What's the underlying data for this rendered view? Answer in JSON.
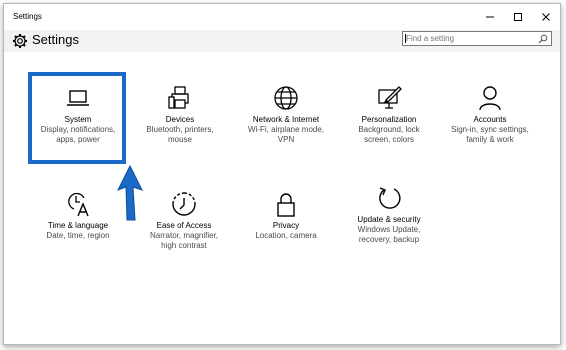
{
  "window": {
    "title": "Settings",
    "minimize": "─",
    "maximize": "☐",
    "close": "✕"
  },
  "header": {
    "title": "Settings",
    "search_placeholder": "Find a setting"
  },
  "accent": "#1b6ac8",
  "tiles": [
    {
      "name": "System",
      "desc1": "Display, notifications,",
      "desc2": "apps, power",
      "icon": "laptop-icon"
    },
    {
      "name": "Devices",
      "desc1": "Bluetooth, printers,",
      "desc2": "mouse",
      "icon": "devices-icon"
    },
    {
      "name": "Network & Internet",
      "desc1": "Wi-Fi, airplane mode,",
      "desc2": "VPN",
      "icon": "globe-icon"
    },
    {
      "name": "Personalization",
      "desc1": "Background, lock",
      "desc2": "screen, colors",
      "icon": "paint-icon"
    },
    {
      "name": "Accounts",
      "desc1": "Sign-in, sync settings,",
      "desc2": "family & work",
      "icon": "person-icon"
    },
    {
      "name": "Time & language",
      "desc1": "Date, time, region",
      "desc2": "",
      "icon": "time-language-icon"
    },
    {
      "name": "Ease of Access",
      "desc1": "Narrator, magnifier,",
      "desc2": "high contrast",
      "icon": "ease-of-access-icon"
    },
    {
      "name": "Privacy",
      "desc1": "Location, camera",
      "desc2": "",
      "icon": "lock-icon"
    },
    {
      "name": "Update & security",
      "desc1": "Windows Update,",
      "desc2": "recovery, backup",
      "icon": "update-icon"
    }
  ]
}
